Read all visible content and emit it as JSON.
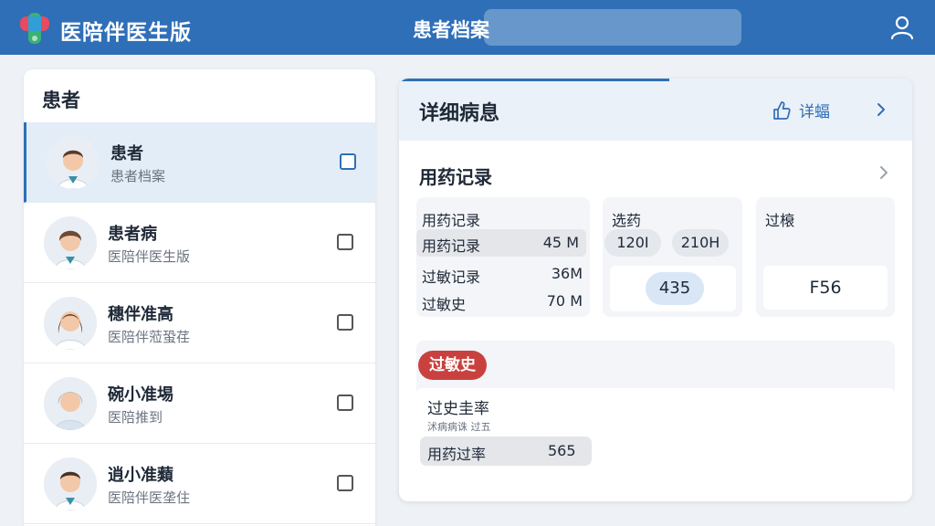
{
  "header": {
    "app_title": "医陪伴医生版",
    "page_title": "患者档案"
  },
  "patients": {
    "heading": "患者",
    "items": [
      {
        "name": "患者",
        "sub": "患者档案"
      },
      {
        "name": "患者病",
        "sub": "医陪伴医生版"
      },
      {
        "name": "穗伴准高",
        "sub": "医陪伴蒞蛩荏"
      },
      {
        "name": "碗小准埸",
        "sub": "医陪推到"
      },
      {
        "name": "逍小准蘱",
        "sub": "医陪伴医垄住"
      }
    ]
  },
  "detail": {
    "title": "详细病息",
    "detail_button": "详蝠",
    "section_title": "用药记录",
    "card1": {
      "label": "用药记录",
      "rows": [
        {
          "label": "用药记录",
          "value": "45 M"
        },
        {
          "label": "过敏记录",
          "value": "36M"
        },
        {
          "label": "过敏史",
          "value": "70 M"
        }
      ]
    },
    "card2": {
      "label": "选药",
      "pill1": "120I",
      "pill2": "210H",
      "main_value": "435"
    },
    "card3": {
      "label": "过榱",
      "main_value": "F56"
    },
    "allergy": {
      "badge": "过敏史",
      "title": "过史圭率",
      "sub": "沭病病诛 过五",
      "row_label": "用药过率",
      "row_value": "565"
    }
  },
  "colors": {
    "primary": "#2f6fb7",
    "alert": "#c9413f",
    "active_row": "#e3edf8"
  }
}
